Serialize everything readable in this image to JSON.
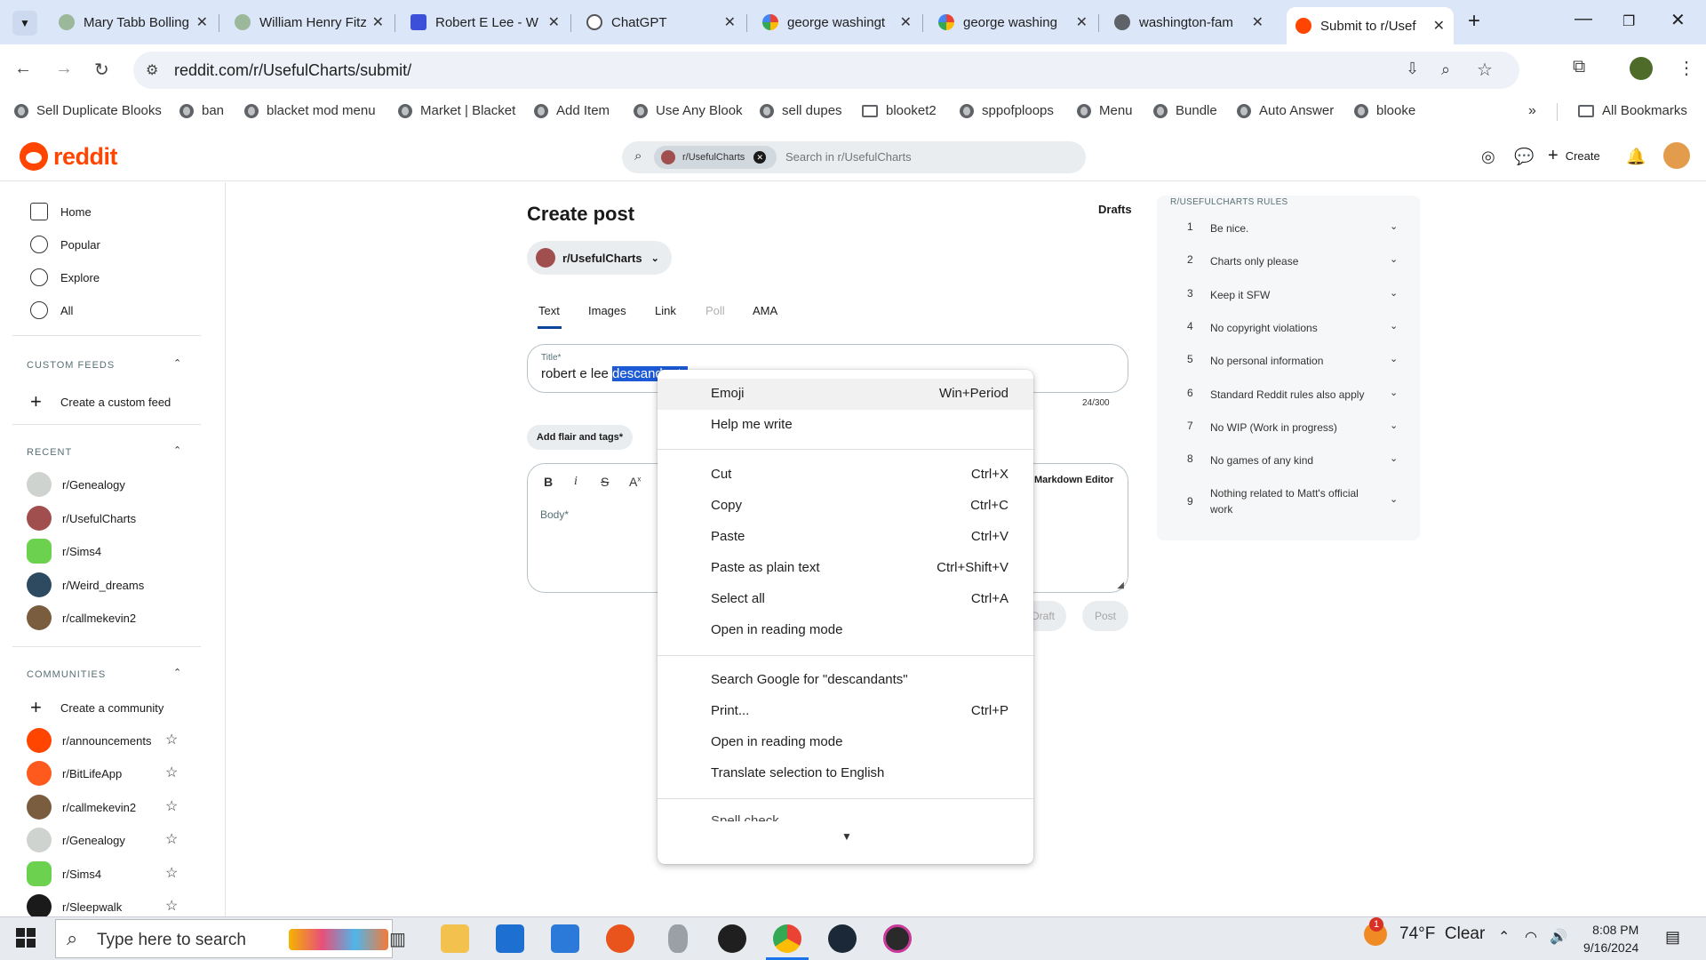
{
  "browser": {
    "tabs": [
      {
        "title": "Mary Tabb Bolling",
        "icon": "leaf-favicon"
      },
      {
        "title": "William Henry Fitzhugh",
        "icon": "leaf-favicon"
      },
      {
        "title": "Robert E Lee - W",
        "icon": "app-favicon"
      },
      {
        "title": "ChatGPT",
        "icon": "chatgpt-favicon"
      },
      {
        "title": "george washingt",
        "icon": "google-favicon"
      },
      {
        "title": "george washing",
        "icon": "google-favicon"
      },
      {
        "title": "washington-fam",
        "icon": "globe-favicon"
      },
      {
        "title": "Submit to r/Usef",
        "icon": "reddit-favicon",
        "active": true
      }
    ],
    "url": "reddit.com/r/UsefulCharts/submit/",
    "bookmarks": [
      {
        "label": "Sell Duplicate Blooks",
        "icon": "globe-icon"
      },
      {
        "label": "ban",
        "icon": "globe-icon"
      },
      {
        "label": "blacket mod menu",
        "icon": "globe-icon"
      },
      {
        "label": "Market | Blacket",
        "icon": "globe-icon"
      },
      {
        "label": "Add Item",
        "icon": "globe-icon"
      },
      {
        "label": "Use Any Blook",
        "icon": "globe-icon"
      },
      {
        "label": "sell dupes",
        "icon": "globe-icon"
      },
      {
        "label": "blooket2",
        "icon": "folder-icon"
      },
      {
        "label": "sppofploops",
        "icon": "globe-icon"
      },
      {
        "label": "Menu",
        "icon": "globe-icon"
      },
      {
        "label": "Bundle",
        "icon": "globe-icon"
      },
      {
        "label": "Auto Answer",
        "icon": "globe-icon"
      },
      {
        "label": "blooke",
        "icon": "globe-icon"
      }
    ],
    "all_bookmarks": "All Bookmarks"
  },
  "reddit": {
    "logo": "reddit",
    "search_chip": "r/UsefulCharts",
    "search_placeholder": "Search in r/UsefulCharts",
    "create_label": "Create",
    "nav": [
      "Home",
      "Popular",
      "Explore",
      "All"
    ],
    "custom_feeds_header": "CUSTOM FEEDS",
    "create_feed": "Create a custom feed",
    "recent_header": "RECENT",
    "recent": [
      "r/Genealogy",
      "r/UsefulCharts",
      "r/Sims4",
      "r/Weird_dreams",
      "r/callmekevin2"
    ],
    "communities_header": "COMMUNITIES",
    "create_community": "Create a community",
    "communities": [
      "r/announcements",
      "r/BitLifeApp",
      "r/callmekevin2",
      "r/Genealogy",
      "r/Sims4",
      "r/Sleepwalk"
    ]
  },
  "post": {
    "heading": "Create post",
    "drafts": "Drafts",
    "subreddit": "r/UsefulCharts",
    "tabs": [
      "Text",
      "Images",
      "Link",
      "Poll",
      "AMA"
    ],
    "title_label": "Title*",
    "title_plain": "robert e lee ",
    "title_selected": "descandants",
    "title_count": "24/300",
    "flair_button": "Add flair and tags*",
    "body_placeholder": "Body*",
    "markdown_editor": "Markdown Editor",
    "save_draft": "Draft",
    "post_button": "Post"
  },
  "rules": {
    "header": "R/USEFULCHARTS RULES",
    "items": [
      "Be nice.",
      "Charts only please",
      "Keep it SFW",
      "No copyright violations",
      "No personal information",
      "Standard Reddit rules also apply",
      "No WIP (Work in progress)",
      "No games of any kind",
      "Nothing related to Matt's official work"
    ]
  },
  "context_menu": {
    "items": [
      {
        "label": "Emoji",
        "shortcut": "Win+Period"
      },
      {
        "label": "Help me write",
        "shortcut": ""
      },
      {
        "label": "Cut",
        "shortcut": "Ctrl+X"
      },
      {
        "label": "Copy",
        "shortcut": "Ctrl+C"
      },
      {
        "label": "Paste",
        "shortcut": "Ctrl+V"
      },
      {
        "label": "Paste as plain text",
        "shortcut": "Ctrl+Shift+V"
      },
      {
        "label": "Select all",
        "shortcut": "Ctrl+A"
      },
      {
        "label": "Open in reading mode",
        "shortcut": ""
      },
      {
        "label": "Search Google for \"descandants\"",
        "shortcut": ""
      },
      {
        "label": "Print...",
        "shortcut": "Ctrl+P"
      },
      {
        "label": "Open in reading mode",
        "shortcut": ""
      },
      {
        "label": "Translate selection to English",
        "shortcut": ""
      }
    ],
    "partial_item": "Spell check"
  },
  "taskbar": {
    "search_placeholder": "Type here to search",
    "weather_badge": "1",
    "weather": "74°F  Clear",
    "time": "8:08 PM",
    "date": "9/16/2024"
  }
}
